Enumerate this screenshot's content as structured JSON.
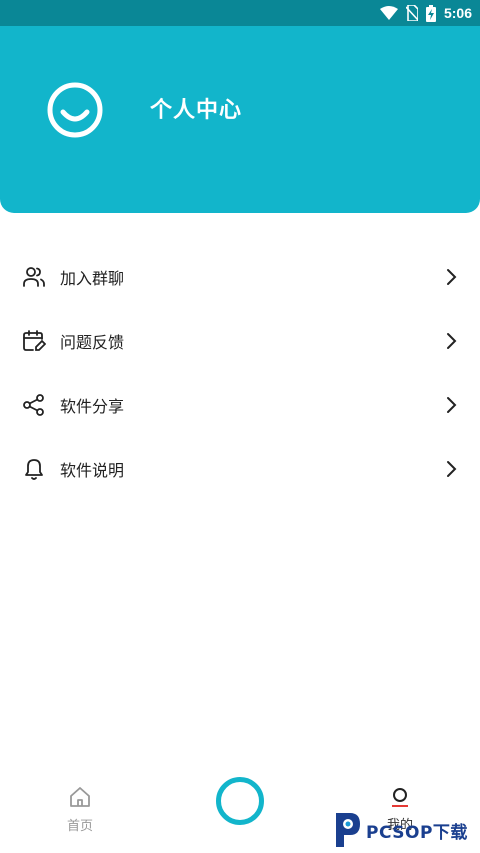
{
  "status_bar": {
    "time": "5:06",
    "icons": [
      "wifi-icon",
      "no-sim-icon",
      "battery-charging-icon"
    ]
  },
  "header": {
    "title": "个人中心",
    "avatar_icon": "smiley-icon",
    "background_color": "#12b5cb"
  },
  "menu": {
    "items": [
      {
        "label": "加入群聊",
        "icon": "users-icon"
      },
      {
        "label": "问题反馈",
        "icon": "calendar-edit-icon"
      },
      {
        "label": "软件分享",
        "icon": "share-icon"
      },
      {
        "label": "软件说明",
        "icon": "bell-icon"
      }
    ]
  },
  "bottom_nav": {
    "home_label": "首页",
    "mine_label": "我的",
    "accent_color": "#12b5cb"
  },
  "watermark": {
    "text": "PCSOP下载"
  }
}
